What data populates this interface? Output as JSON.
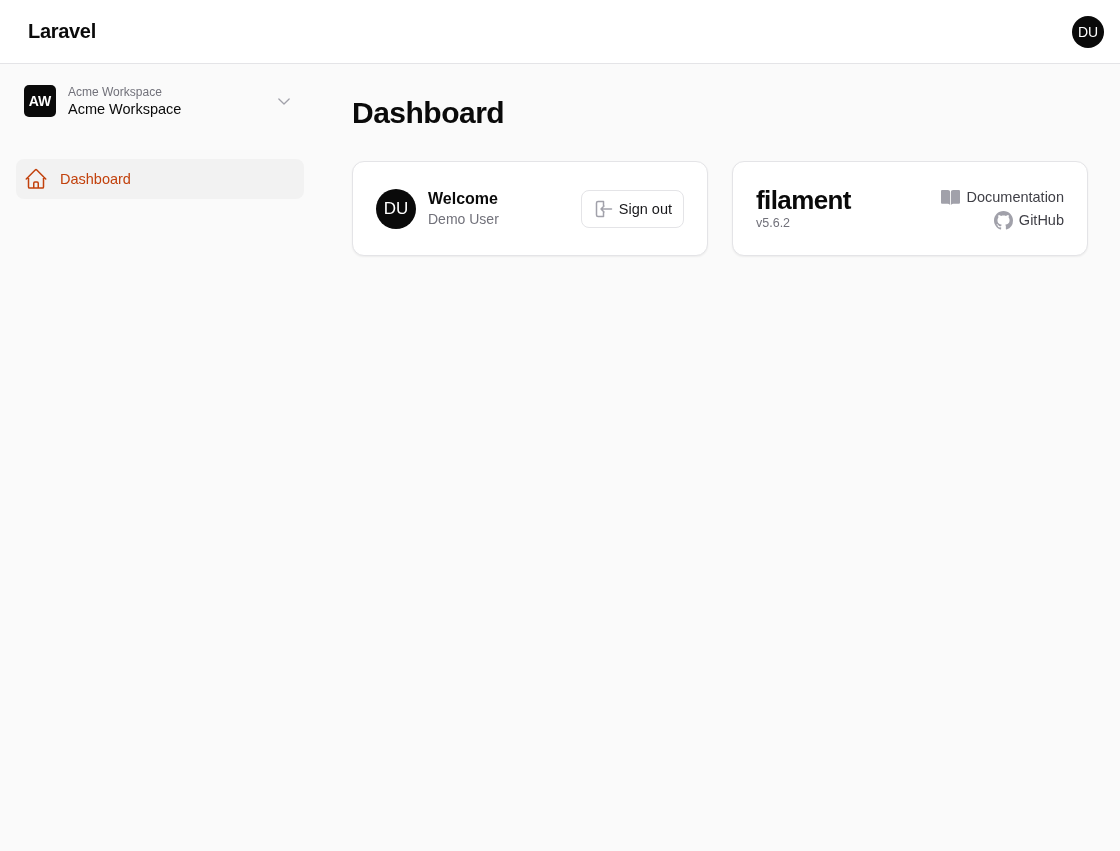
{
  "top_bar": {
    "brand": "Laravel",
    "user_avatar": "DU"
  },
  "sidebar": {
    "workspace": {
      "initials": "AW",
      "label": "Acme Workspace",
      "name": "Acme Workspace"
    },
    "items": [
      {
        "label": "Dashboard",
        "selected": true
      }
    ]
  },
  "page": {
    "title": "Dashboard"
  },
  "account_widget": {
    "avatar": "DU",
    "greeting": "Welcome",
    "user_name": "Demo User",
    "button": "Sign out"
  },
  "info_widget": {
    "logo": "filament",
    "version": "v5.6.2",
    "links": [
      {
        "label": "Documentation",
        "kind": "docs"
      },
      {
        "label": "GitHub",
        "kind": "github"
      }
    ]
  }
}
